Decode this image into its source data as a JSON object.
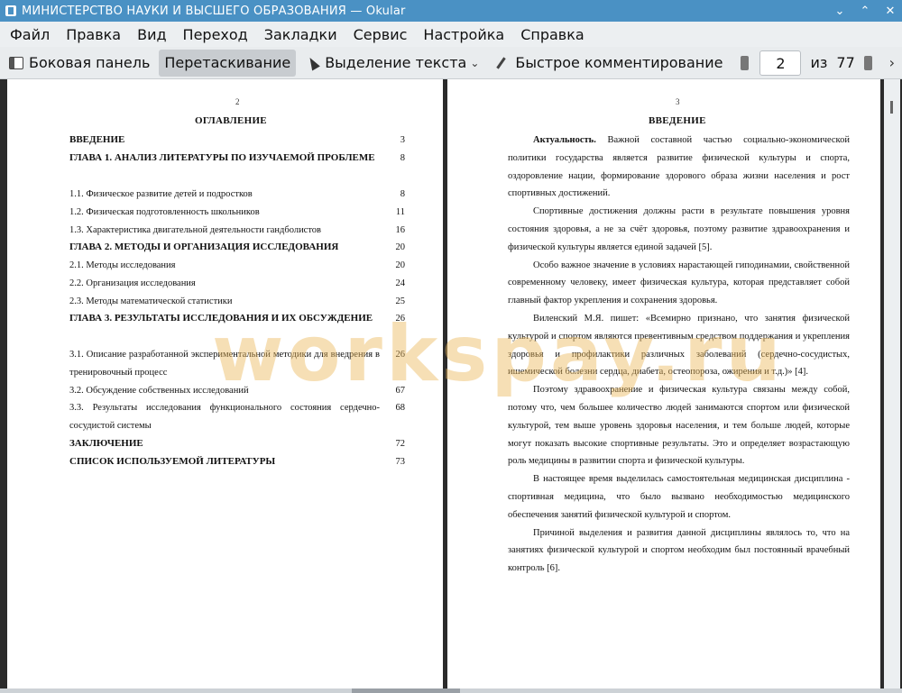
{
  "window": {
    "title": "МИНИСТЕРСТВО НАУКИ И ВЫСШЕГО ОБРАЗОВАНИЯ   — Okular",
    "controls": {
      "minimize": "⌄",
      "maximize": "⌃",
      "close": "✕"
    }
  },
  "menu": [
    "Файл",
    "Правка",
    "Вид",
    "Переход",
    "Закладки",
    "Сервис",
    "Настройка",
    "Справка"
  ],
  "toolbar": {
    "sidebar": "Боковая панель",
    "drag": "Перетаскивание",
    "select": "Выделение текста",
    "select_arrow": "⌄",
    "comment": "Быстрое комментирование",
    "page_current": "2",
    "of": "из",
    "page_total": "77",
    "more": "›"
  },
  "left_page": {
    "number": "2",
    "heading": "ОГЛАВЛЕНИЕ",
    "toc": [
      {
        "title": "ВВЕДЕНИЕ",
        "page": "3",
        "bold": true
      },
      {
        "title": "ГЛАВА 1. АНАЛИЗ ЛИТЕРАТУРЫ ПО ИЗУЧАЕМОЙ ПРОБЛЕМЕ",
        "page": "8",
        "bold": true
      },
      {
        "title": "1.1.     Физическое развитие детей и подростков",
        "page": "8",
        "bold": false
      },
      {
        "title": "1.2. Физическая подготовленность школьников",
        "page": "11",
        "bold": false
      },
      {
        "title": "1.3. Характеристика двигательной деятельности гандболистов",
        "page": "16",
        "bold": false
      },
      {
        "title": "ГЛАВА 2. МЕТОДЫ И ОРГАНИЗАЦИЯ ИССЛЕДОВАНИЯ",
        "page": "20",
        "bold": true
      },
      {
        "title": "2.1. Методы исследования",
        "page": "20",
        "bold": false
      },
      {
        "title": "2.2. Организация исследования",
        "page": "24",
        "bold": false
      },
      {
        "title": "2.3. Методы математической статистики",
        "page": "25",
        "bold": false
      },
      {
        "title": "ГЛАВА 3. РЕЗУЛЬТАТЫ ИССЛЕДОВАНИЯ И ИХ ОБСУЖДЕНИЕ",
        "page": "26",
        "bold": true
      },
      {
        "title": "3.1.  Описание разработанной экспериментальной методики для внедрения в тренировочный процесс",
        "page": "26",
        "bold": false
      },
      {
        "title": "3.2. Обсуждение собственных исследований",
        "page": "67",
        "bold": false
      },
      {
        "title": "3.3. Результаты исследования функционального состояния сердечно-сосудистой системы",
        "page": "68",
        "bold": false
      },
      {
        "title": "ЗАКЛЮЧЕНИЕ",
        "page": "72",
        "bold": true
      },
      {
        "title": "СПИСОК ИСПОЛЬЗУЕМОЙ ЛИТЕРАТУРЫ",
        "page": "73",
        "bold": true
      }
    ]
  },
  "right_page": {
    "number": "3",
    "heading": "ВВЕДЕНИЕ",
    "p1_label": "Актуальность.",
    "p1": " Важной составной частью социально-экономической политики государства является развитие физической культуры и спорта, оздоровление нации, формирование здорового образа жизни населения и рост спортивных достижений.",
    "p2": "Спортивные достижения должны расти в результате повышения уровня состояния здоровья, а не за счёт здоровья, поэтому развитие здравоохранения и физической культуры является единой задачей [5].",
    "p3": "Особо важное значение в условиях нарастающей гиподинамии, свойственной современному человеку, имеет физическая культура, которая представляет собой главный фактор укрепления и сохранения здоровья.",
    "p4": "Виленский М.Я. пишет: «Всемирно признано, что занятия физической культурой и спортом являются превентивным средством поддержания и укрепления здоровья и профилактики различных заболеваний (сердечно-сосудистых, ишемической болезни сердца, диабета, остеопороза, ожирения и т.д.)» [4].",
    "p5": "Поэтому здравоохранение и физическая культура связаны между собой, потому что, чем большее количество людей занимаются спортом или физической культурой, тем выше уровень здоровья населения, и тем больше людей, которые могут показать высокие спортивные результаты. Это и определяет возрастающую роль медицины в развитии спорта и физической культуры.",
    "p6": "В настоящее время выделилась самостоятельная медицинская дисциплина - спортивная медицина, что было вызвано необходимостью медицинского обеспечения занятий физической культурой и спортом.",
    "p7": "Причиной выделения и развития данной дисциплины являлось то, что на занятиях физической культурой и спортом необходим был постоянный врачебный контроль [6]."
  },
  "watermark": "workspay.ru"
}
